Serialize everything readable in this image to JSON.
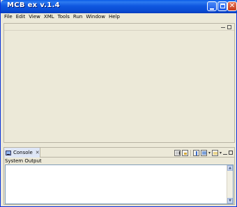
{
  "window": {
    "title": "MCB ex v.1.4",
    "close_glyph": "✕"
  },
  "menubar": {
    "items": [
      "File",
      "Edit",
      "View",
      "XML",
      "Tools",
      "Run",
      "Window",
      "Help"
    ]
  },
  "console": {
    "tab_label": "Console",
    "tab_close": "✕",
    "header": "System Output",
    "output": ""
  },
  "scrollbar": {
    "up": "▲",
    "down": "▼"
  },
  "colors": {
    "titlebar": "#0a4cd3",
    "background": "#ece9d8",
    "tab_active": "#dfe7f6"
  }
}
